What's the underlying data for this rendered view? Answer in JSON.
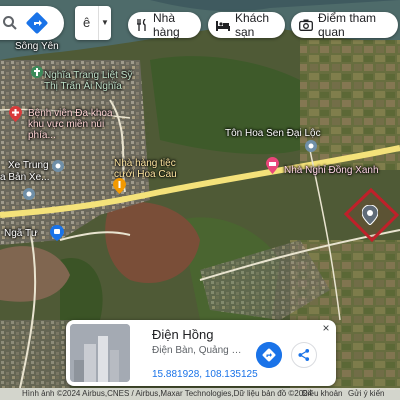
{
  "map": {
    "labels": {
      "song_yen": "Sông Yên",
      "cemetery": "Nghĩa Trang Liệt Sỹ Thị Trấn Ái Nghĩa",
      "hospital": "Bệnh viện Đa khoa khu vực miền núi phía...",
      "xe_trung": "Xe Trung",
      "ban_xe": "a Bản Xe...",
      "restaurant": "Nhà hàng tiệc cưới Hoa Cau",
      "flower_shop": "Tôn Hoa Sen Đại Lộc",
      "guesthouse": "Nhà Nghỉ Đồng Xanh",
      "nga_tu": "Ngã Tư"
    },
    "icons": [
      "hospital-icon",
      "restaurant-icon",
      "guesthouse-icon",
      "place-pin-icon",
      "cemetery-icon"
    ]
  },
  "search": {
    "icon": "search-icon",
    "directions_icon": "directions-icon"
  },
  "layer_button": {
    "label": "ê",
    "dropdown": "▼"
  },
  "chips": [
    {
      "label": "Nhà hàng",
      "icon": "restaurant-icon"
    },
    {
      "label": "Khách sạn",
      "icon": "hotel-icon"
    },
    {
      "label": "Điểm tham quan",
      "icon": "camera-icon"
    }
  ],
  "place_card": {
    "title": "Điện Hồng",
    "subtitle": "Điện Bàn, Quảng Nam, V...",
    "coordinates": "15.881928, 108.135125",
    "close": "×"
  },
  "footer": {
    "imagery": "Hình ảnh ©2024 Airbus,CNES / Airbus,Maxar Technologies,Dữ liệu bản đồ ©2024",
    "terms": "Điều khoản",
    "feedback": "Gửi ý kiến"
  },
  "colors": {
    "accent": "#1a73e8",
    "road": "#f4e27a",
    "boundary": "#c0202a"
  }
}
